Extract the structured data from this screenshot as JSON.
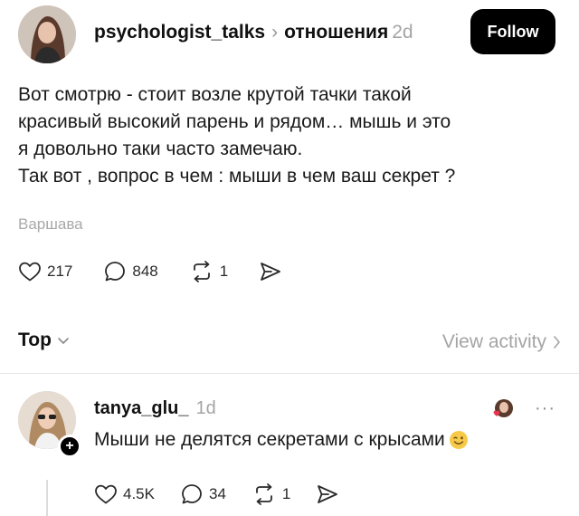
{
  "post": {
    "author": "psychologist_talks",
    "separator": "›",
    "topic": "отношения",
    "age": "2d",
    "follow_label": "Follow",
    "lines": [
      "Вот смотрю - стоит возле крутой тачки такой",
      "красивый высокий парень и рядом… мышь и это",
      "я довольно таки часто замечаю.",
      "Так вот , вопрос в чем : мыши в чем ваш секрет ?"
    ],
    "location": "Варшава",
    "likes": "217",
    "comments": "848",
    "reposts": "1",
    "icons": [
      "heart-icon",
      "comment-icon",
      "repost-icon",
      "share-icon"
    ]
  },
  "sort": {
    "label": "Top",
    "view_activity": "View activity"
  },
  "reply": {
    "author": "tanya_glu_",
    "age": "1d",
    "text": "Мыши не делятся секретами с крысами",
    "emoji": "winking-face",
    "more": "···",
    "likes": "4.5K",
    "comments": "34",
    "reposts": "1"
  },
  "colors": {
    "follow_bg": "#000000",
    "muted_text": "#a4a4a4",
    "divider": "#e6e6e6"
  }
}
